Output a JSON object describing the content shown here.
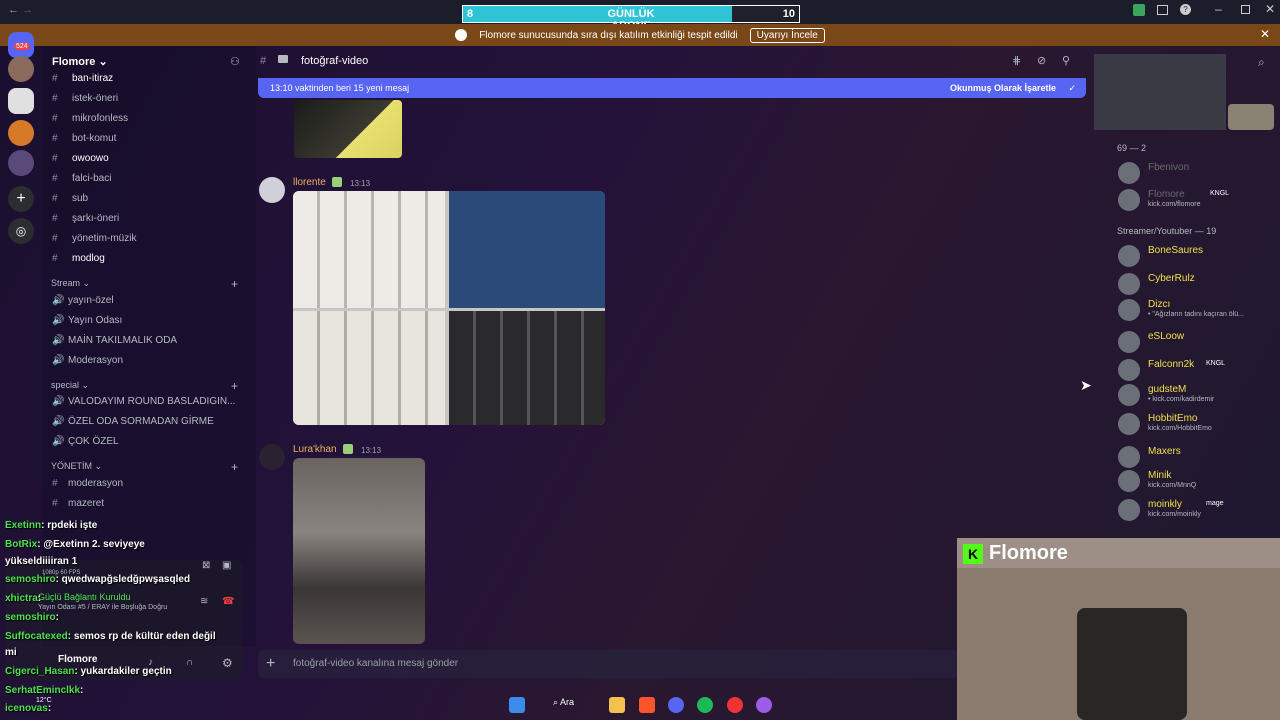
{
  "subgoal": {
    "left": "8",
    "title": "GÜNLÜK ABONE",
    "right": "10",
    "progress": 0.8
  },
  "notice": {
    "text": "Flomore sunucusunda sıra dışı katılım etkinliği tespit edildi",
    "button": "Uyarıyı İncele"
  },
  "rail": {
    "badge": "524"
  },
  "server": {
    "name": "Flomore"
  },
  "channels": [
    {
      "label": "ban-itiraz",
      "unread": true
    },
    {
      "label": "istek-öneri",
      "unread": false
    },
    {
      "label": "mikrofonless",
      "unread": false
    },
    {
      "label": "bot-komut",
      "unread": false
    },
    {
      "label": "owoowo",
      "unread": true
    },
    {
      "label": "falci-baci",
      "unread": false
    },
    {
      "label": "sub",
      "unread": false
    },
    {
      "label": "şarkı-öneri",
      "unread": false
    },
    {
      "label": "yönetim-müzik",
      "unread": false
    },
    {
      "label": "modlog",
      "unread": true
    }
  ],
  "categories": {
    "stream": "Stream",
    "special": "special",
    "yonetim": "YÖNETİM"
  },
  "stream_channels": [
    "yayın-özel",
    "Yayın Odası",
    "MAİN TAKILMALIK ODA",
    "Moderasyon"
  ],
  "special_channels": [
    "VALODAYIM ROUND BASLADIGIN...",
    "ÖZEL ODA SORMADAN GİRME",
    "ÇOK ÖZEL"
  ],
  "yonetim_channels": [
    "moderasyon",
    "mazeret"
  ],
  "header": {
    "channel": "fotoğraf-video"
  },
  "newbar": {
    "left": "13:10 vaktinden beri 15 yeni mesaj",
    "right": "Okunmuş Olarak İşaretle"
  },
  "messages": [
    {
      "user": "llorente",
      "time": "13:13",
      "color": "#e8b25c"
    },
    {
      "user": "Lura'khan",
      "time": "13:13",
      "color": "#e8b25c"
    }
  ],
  "composer": {
    "placeholder": "fotoğraf-video kanalına mesaj gönder"
  },
  "members": {
    "group1": "69 — 2",
    "top": [
      {
        "name": "Fbenivon",
        "status": ""
      },
      {
        "name": "Flomore",
        "status": "kick.com/flomore",
        "tag": "KNGL"
      }
    ],
    "group2": "Streamer/Youtuber — 19",
    "list": [
      {
        "name": "BoneSaures",
        "status": ""
      },
      {
        "name": "CyberRulz",
        "status": ""
      },
      {
        "name": "Dizcı",
        "status": "• \"Ağızların tadını kaçıran ölü..."
      },
      {
        "name": "eSLoow",
        "status": ""
      },
      {
        "name": "Falconn2k",
        "status": "",
        "tag": "KNGL"
      },
      {
        "name": "gudsteM",
        "status": "• kick.com/kadirdemir"
      },
      {
        "name": "HobbitEmo",
        "status": "kick.com/HobbitEmo"
      },
      {
        "name": "Maxers",
        "status": ""
      },
      {
        "name": "Minik",
        "status": "kick.com/MnnQ"
      },
      {
        "name": "moinkly",
        "status": "kick.com/moinkly",
        "tag": "mage"
      }
    ]
  },
  "overlay_chat": [
    {
      "user": "Exetinn",
      "text": ": rpdeki işte"
    },
    {
      "user": "BotRix",
      "text": ": @Exetinn 2. seviyeye"
    },
    {
      "user": "",
      "text": "yükseldiiiiran 1"
    },
    {
      "user": "semoshiro",
      "text": ": qwedwapğsledğpwşasqled"
    },
    {
      "user": "xhictra",
      "text": ":"
    },
    {
      "user": "semoshiro",
      "text": ":"
    },
    {
      "user": "Suffocatexed",
      "text": ": semos rp de kültür eden değil"
    },
    {
      "user": "",
      "text": "mi"
    },
    {
      "user": "Cigerci_Hasan",
      "text": ": yukardakiler geçtin"
    },
    {
      "user": "SerhatEminclkk",
      "text": ":"
    },
    {
      "user": "icenovas",
      "text": ":"
    }
  ],
  "voice": {
    "status": "Güçlü Bağlantı Kuruldu",
    "sub": "Yayın Odası #5 / ERAY ile Boşluğa Doğru",
    "quality": "1080p 60 FPS",
    "user": "Flomore"
  },
  "taskbar": {
    "search": "Ara",
    "weather": "12°C"
  },
  "cam": {
    "brand": "Flomore"
  }
}
